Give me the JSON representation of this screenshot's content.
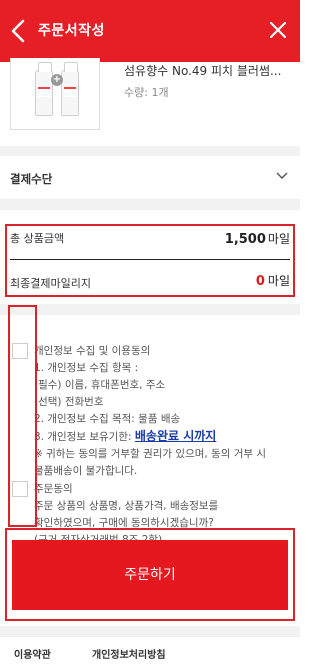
{
  "header": {
    "title": "주문서작성"
  },
  "product": {
    "name": "섬유향수 No.49 피치 블러썸...",
    "qty": "수량: 1개",
    "plus": "+"
  },
  "payment": {
    "label": "결제수단"
  },
  "summary": {
    "total_label": "총 상품금액",
    "total_value": "1,500",
    "total_unit": "마일",
    "final_label": "최종결제마일리지",
    "final_value": "0",
    "final_unit": "마일"
  },
  "agreements": {
    "privacy_title": "개인정보 수집 및 이용동의",
    "privacy_line1": "1. 개인정보 수집 항목 :",
    "privacy_line2": "(필수) 이름, 휴대폰번호, 주소",
    "privacy_line3": "(선택) 전화번호",
    "privacy_line4": "2. 개인정보 수집 목적: 물품 배송",
    "privacy_line5_prefix": "3. 개인정보 보유기한: ",
    "privacy_line5_link": "배송완료 시까지",
    "privacy_line6": "※ 귀하는 동의를 거부할 권리가 있으며, 동의 거부 시",
    "privacy_line7": "물품배송이 불가합니다.",
    "order_title": "주문동의",
    "order_line1": "주문 상품의 상품명, 상품가격, 배송정보를",
    "order_line2": "확인하였으며, 구매에 동의하시겠습니까?",
    "order_line3": "(근거 전자상거래법 8조 2항)"
  },
  "order_button": {
    "label": "주문하기"
  },
  "footer": {
    "terms": "이용약관",
    "privacy": "개인정보처리방침"
  },
  "colors": {
    "brand_red": "#e61e25",
    "link_blue": "#1a3ca8"
  },
  "icons": {
    "back": "chevron-left-icon",
    "close": "close-icon",
    "expand": "chevron-down-icon"
  }
}
